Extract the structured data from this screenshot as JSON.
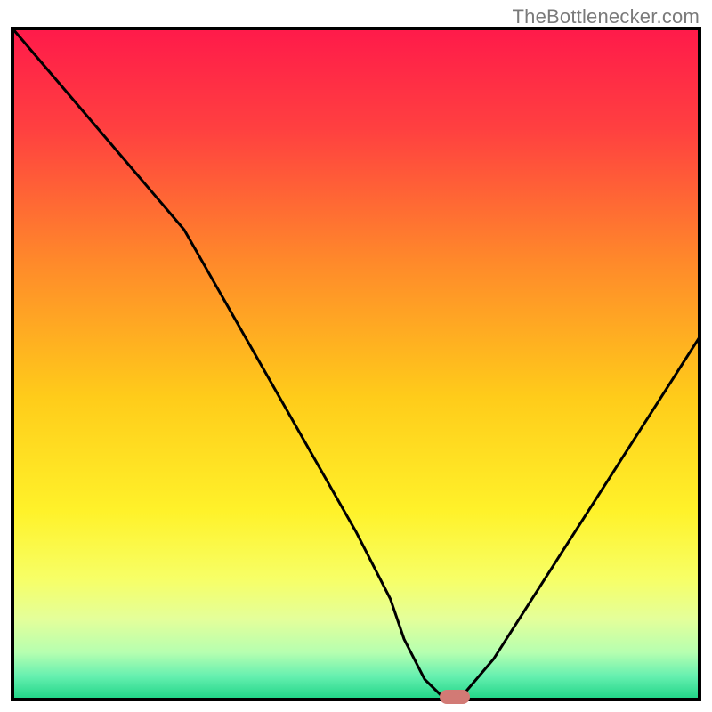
{
  "attribution": {
    "text": "TheBottlenecker.com"
  },
  "chart_data": {
    "type": "line",
    "title": "",
    "xlabel": "",
    "ylabel": "",
    "xlim": [
      0,
      100
    ],
    "ylim": [
      0,
      100
    ],
    "x": [
      0,
      5,
      10,
      15,
      20,
      25,
      30,
      35,
      40,
      45,
      50,
      55,
      57,
      60,
      63,
      65,
      70,
      75,
      80,
      85,
      90,
      95,
      100
    ],
    "series": [
      {
        "name": "bottleneck-curve",
        "values": [
          100,
          94,
          88,
          82,
          76,
          70,
          61,
          52,
          43,
          34,
          25,
          15,
          9,
          3,
          0,
          0,
          6,
          14,
          22,
          30,
          38,
          46,
          54
        ]
      }
    ],
    "marker": {
      "x": 64,
      "width": 3.6,
      "color": "#d27a75"
    },
    "axes_visible": false,
    "grid": false,
    "background": {
      "type": "vertical-gradient",
      "stops": [
        {
          "pos": 0.0,
          "color": "#ff1a4a"
        },
        {
          "pos": 0.15,
          "color": "#ff4040"
        },
        {
          "pos": 0.35,
          "color": "#ff8a2a"
        },
        {
          "pos": 0.55,
          "color": "#ffcc1a"
        },
        {
          "pos": 0.72,
          "color": "#fff22a"
        },
        {
          "pos": 0.82,
          "color": "#f7ff66"
        },
        {
          "pos": 0.88,
          "color": "#e4ff9a"
        },
        {
          "pos": 0.93,
          "color": "#b6ffb0"
        },
        {
          "pos": 0.965,
          "color": "#66f0b0"
        },
        {
          "pos": 1.0,
          "color": "#1ed486"
        }
      ]
    },
    "frame": {
      "color": "#000000",
      "width": 4
    }
  }
}
